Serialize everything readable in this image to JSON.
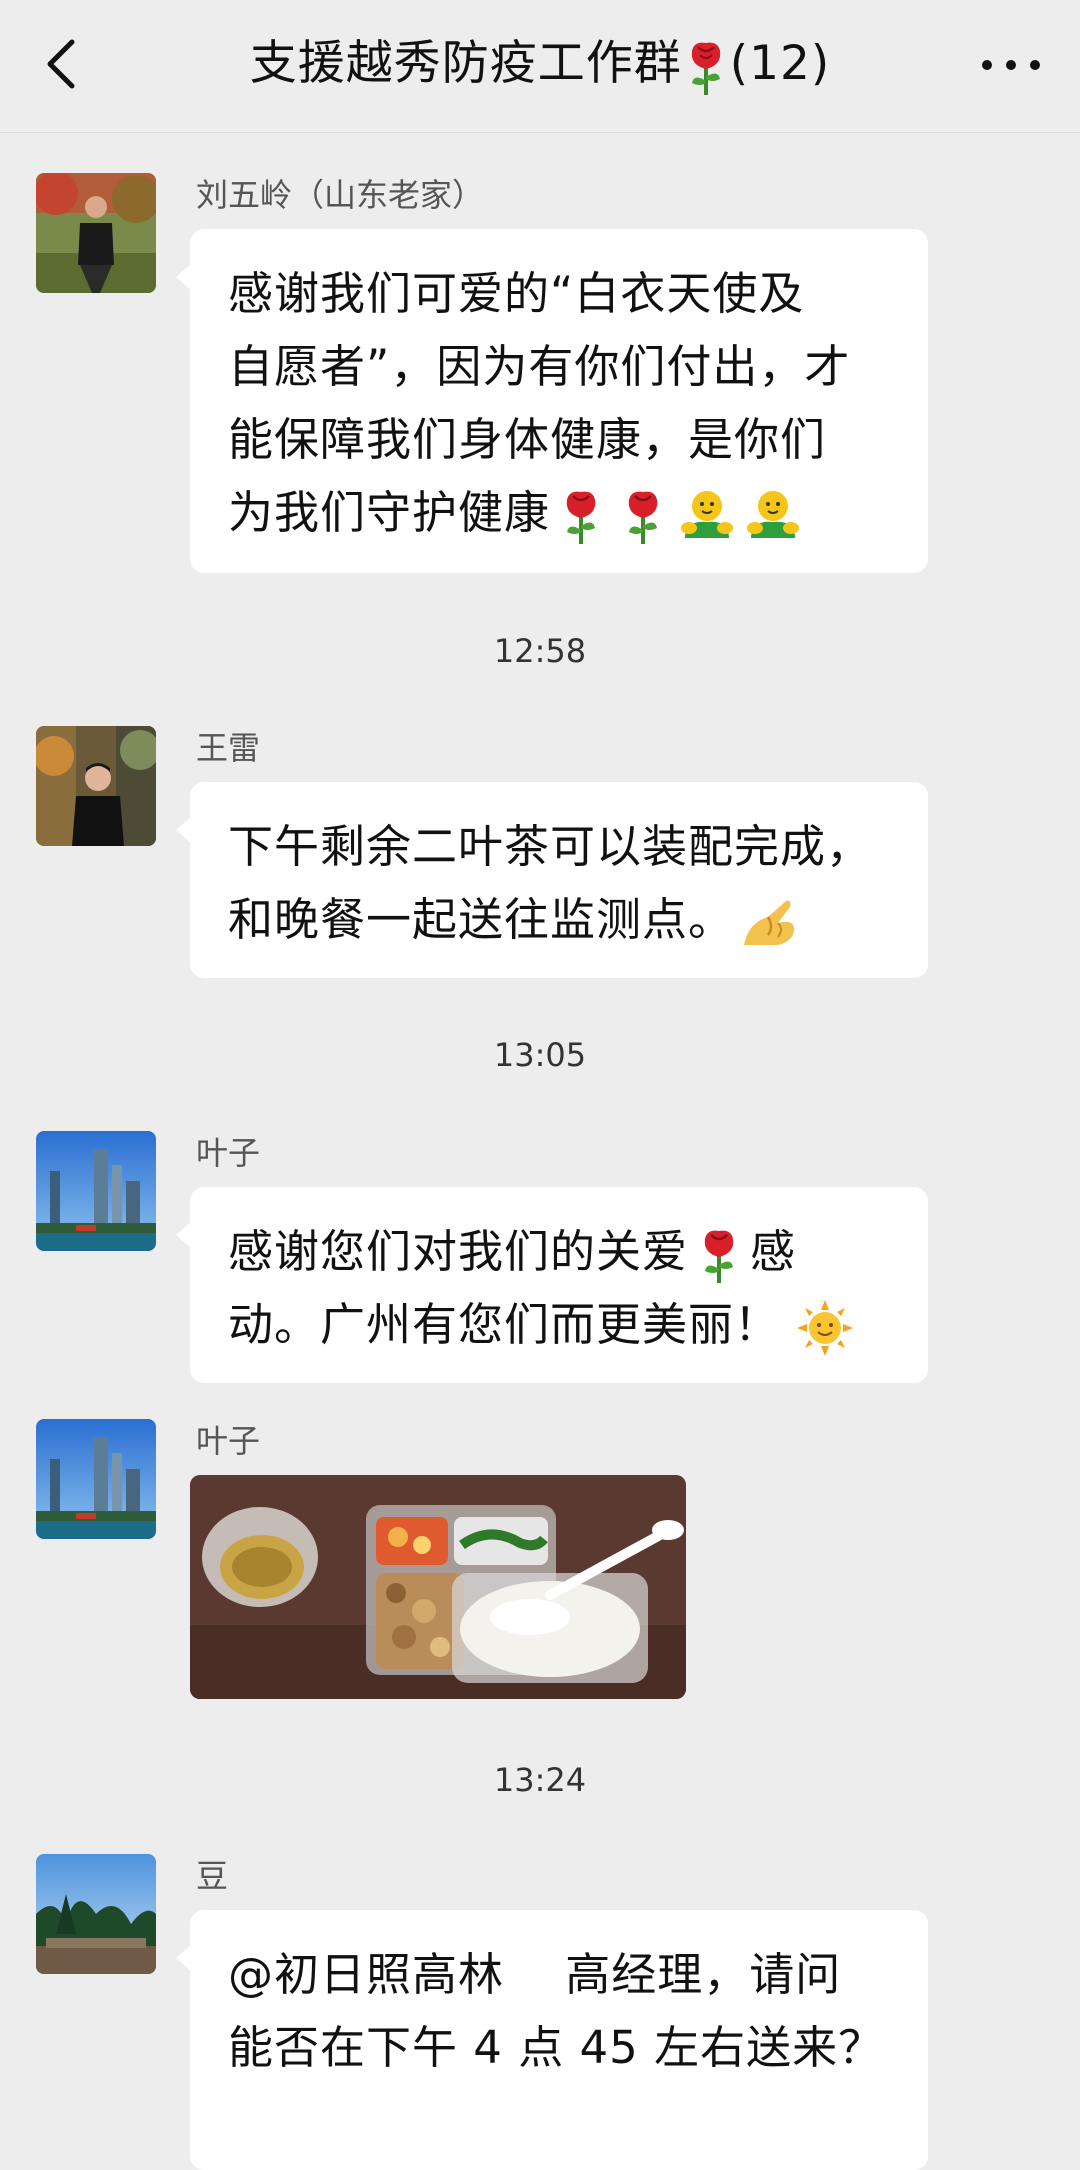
{
  "header": {
    "title_prefix": "支援越秀防疫工作群",
    "title_suffix": "(12)"
  },
  "messages": [
    {
      "sender": "刘五岭（山东老家）",
      "lines": [
        "感谢我们可爱的“白衣天使及",
        "自愿者”，因为有你们付出，才",
        "能保障我们身体健康，是你们",
        "为我们守护健康"
      ]
    },
    {
      "timestamp": "12:58"
    },
    {
      "sender": "王雷",
      "lines": [
        "下午剩余二叶茶可以装配完成，",
        "和晚餐一起送往监测点。"
      ]
    },
    {
      "timestamp": "13:05"
    },
    {
      "sender": "叶子",
      "lines": [
        "感谢您们对我们的关爱",
        "动。广州有您们而更美丽！"
      ],
      "line1_tail": "感"
    },
    {
      "sender": "叶子",
      "image": "meal-photo"
    },
    {
      "timestamp": "13:24"
    },
    {
      "sender": "豆",
      "lines": [
        "@初日照高林　 高经理，请问",
        "能否在下午 4 点 45 左右送来？"
      ]
    }
  ],
  "icons": {
    "back": "chevron-left-icon",
    "more": "more-dots-icon",
    "rose": "rose-emoji",
    "hug": "hug-emoji",
    "ok_hand": "ok-hand-emoji",
    "sun": "sun-emoji"
  },
  "colors": {
    "background": "#ededed",
    "bubble": "#ffffff",
    "text": "#111111",
    "sender": "#555555"
  }
}
